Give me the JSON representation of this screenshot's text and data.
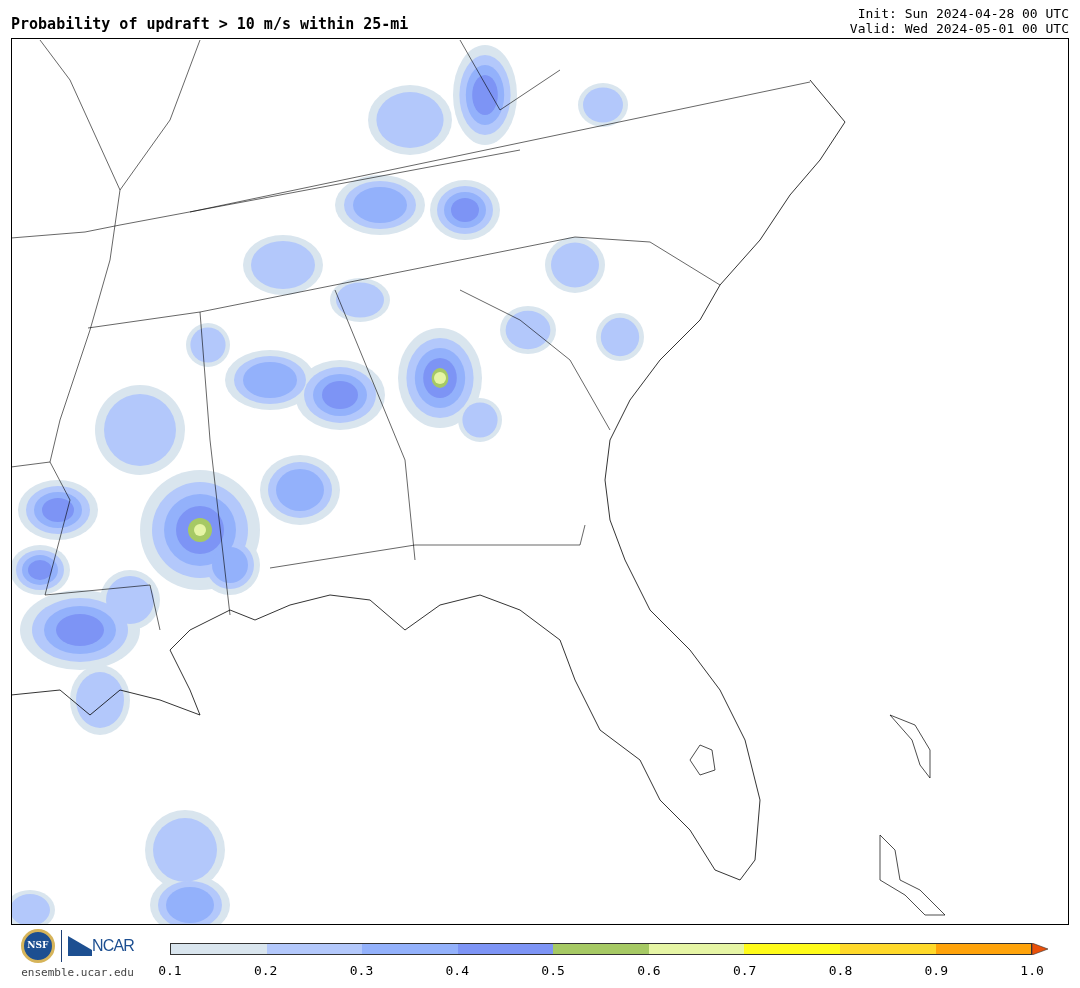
{
  "header": {
    "title": "Probability of updraft > 10 m/s within 25-mi",
    "init": "Init: Sun 2024-04-28 00 UTC",
    "valid": "Valid: Wed 2024-05-01 00 UTC"
  },
  "footer": {
    "nsf": "NSF",
    "ncar": "NCAR",
    "site": "ensemble.ucar.edu"
  },
  "colorbar": {
    "segments": [
      {
        "color": "#d9e5ee"
      },
      {
        "color": "#b3c8fb"
      },
      {
        "color": "#93b1fb"
      },
      {
        "color": "#7d94f5"
      },
      {
        "color": "#a6c964"
      },
      {
        "color": "#e6f5a5"
      },
      {
        "color": "#fffb1a"
      },
      {
        "color": "#ffd92a"
      },
      {
        "color": "#ffa30a"
      }
    ],
    "ticks": [
      "0.1",
      "0.2",
      "0.3",
      "0.4",
      "0.5",
      "0.6",
      "0.7",
      "0.8",
      "0.9",
      "1.0"
    ]
  }
}
